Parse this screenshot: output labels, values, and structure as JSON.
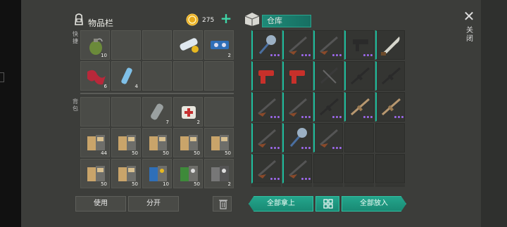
{
  "inventory": {
    "title": "物品栏",
    "quick_label": "快捷",
    "backpack_label": "背包"
  },
  "currency": {
    "amount": "275",
    "add_symbol": "+"
  },
  "warehouse": {
    "title": "仓库"
  },
  "close": {
    "symbol": "✕",
    "label": "关闭"
  },
  "inventory_slots": [
    {
      "item": "grenade-icon",
      "count": "10"
    },
    {
      "item": "",
      "count": ""
    },
    {
      "item": "",
      "count": ""
    },
    {
      "item": "scroll-blueprint-icon",
      "count": ""
    },
    {
      "item": "blue-kit-icon",
      "count": "2"
    },
    {
      "item": "red-cloth-icon",
      "count": "6"
    },
    {
      "item": "water-bottle-icon",
      "count": "4"
    },
    {
      "item": "",
      "count": ""
    },
    {
      "item": "",
      "count": ""
    },
    {
      "item": "",
      "count": ""
    }
  ],
  "backpack_slots": [
    {
      "item": "",
      "count": ""
    },
    {
      "item": "",
      "count": ""
    },
    {
      "item": "gas-canister-icon",
      "count": "7"
    },
    {
      "item": "first-aid-icon",
      "count": "2"
    },
    {
      "item": "",
      "count": ""
    },
    {
      "item": "book-icon",
      "count": "44"
    },
    {
      "item": "book-icon",
      "count": "50"
    },
    {
      "item": "book-icon",
      "count": "50"
    },
    {
      "item": "book-icon",
      "count": "50"
    },
    {
      "item": "book-icon",
      "count": "50"
    },
    {
      "item": "book-icon",
      "count": "50"
    },
    {
      "item": "book-icon",
      "count": "50"
    },
    {
      "item": "blue-book-icon",
      "count": "10"
    },
    {
      "item": "green-book-icon",
      "count": "50"
    },
    {
      "item": "grey-book-icon",
      "count": "2"
    }
  ],
  "warehouse_slots": [
    {
      "item": "spiked-mace-icon",
      "rarity": "teal",
      "dots": 4
    },
    {
      "item": "shotgun-icon",
      "rarity": "teal",
      "dots": 4
    },
    {
      "item": "shotgun-icon",
      "rarity": "teal",
      "dots": 4
    },
    {
      "item": "smg-icon",
      "rarity": "teal",
      "dots": 4
    },
    {
      "item": "machete-icon",
      "rarity": "teal",
      "dots": 0
    },
    {
      "item": "flare-gun-icon",
      "rarity": "teal",
      "dots": 0
    },
    {
      "item": "flare-gun-icon",
      "rarity": "teal",
      "dots": 0
    },
    {
      "item": "crossbow-icon",
      "rarity": "teal",
      "dots": 0
    },
    {
      "item": "rifle-icon",
      "rarity": "teal",
      "dots": 0
    },
    {
      "item": "rifle-icon",
      "rarity": "teal",
      "dots": 0
    },
    {
      "item": "shotgun-icon",
      "rarity": "teal",
      "dots": 4
    },
    {
      "item": "shotgun-icon",
      "rarity": "teal",
      "dots": 4
    },
    {
      "item": "rifle-icon",
      "rarity": "teal",
      "dots": 4
    },
    {
      "item": "tan-rifle-icon",
      "rarity": "teal",
      "dots": 4
    },
    {
      "item": "tan-rifle-icon",
      "rarity": "teal",
      "dots": 4
    },
    {
      "item": "shotgun-icon",
      "rarity": "teal",
      "dots": 4
    },
    {
      "item": "spiked-mace-icon",
      "rarity": "teal",
      "dots": 4
    },
    {
      "item": "shotgun-icon",
      "rarity": "teal",
      "dots": 4
    },
    {
      "item": "",
      "rarity": "",
      "dots": 0
    },
    {
      "item": "",
      "rarity": "",
      "dots": 0
    },
    {
      "item": "shotgun-icon",
      "rarity": "teal",
      "dots": 4
    },
    {
      "item": "shotgun-icon",
      "rarity": "teal",
      "dots": 4
    },
    {
      "item": "",
      "rarity": "",
      "dots": 0
    },
    {
      "item": "",
      "rarity": "",
      "dots": 0
    },
    {
      "item": "",
      "rarity": "",
      "dots": 0
    }
  ],
  "buttons": {
    "use": "使用",
    "split": "分开",
    "take_all": "全部拿上",
    "put_all": "全部放入"
  },
  "colors": {
    "accent": "#1fbf9f",
    "rarity_dot": "#a06af0",
    "panel": "#3c3d3a"
  }
}
